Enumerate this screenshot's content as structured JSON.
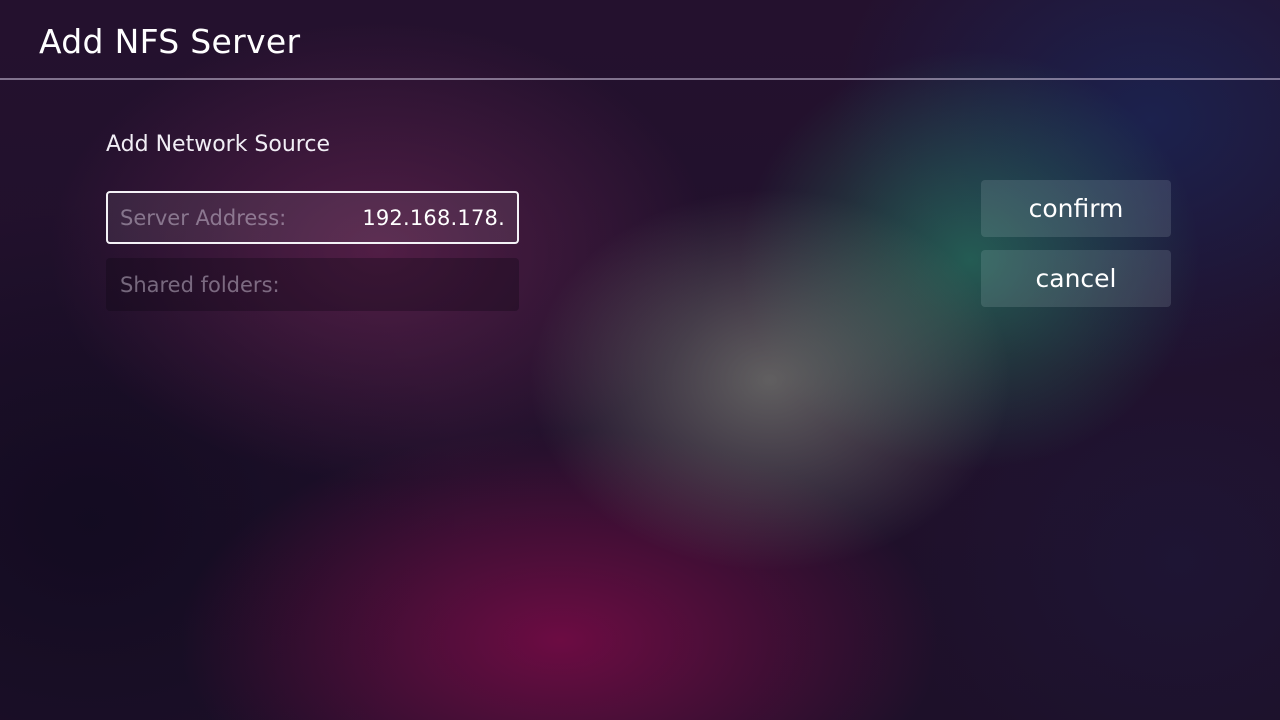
{
  "header": {
    "title": "Add NFS Server"
  },
  "form": {
    "section_title": "Add Network Source",
    "server_address": {
      "label": "Server Address:",
      "value": "192.168.178."
    },
    "shared_folders": {
      "label": "Shared folders:",
      "value": ""
    }
  },
  "actions": {
    "confirm_label": "confirm",
    "cancel_label": "cancel"
  },
  "colors": {
    "text_primary": "#ffffff",
    "focus_border": "#f4f2f7"
  }
}
